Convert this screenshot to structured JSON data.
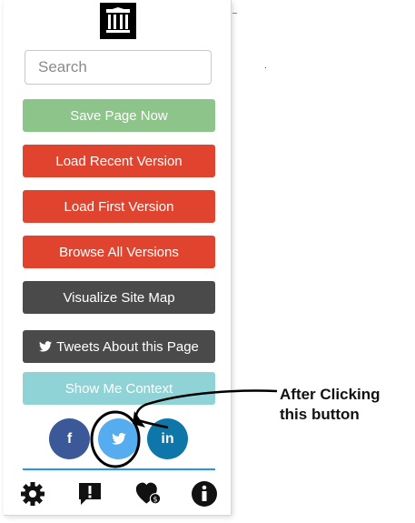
{
  "search": {
    "placeholder": "Search"
  },
  "buttons": {
    "save_page": "Save Page Now",
    "load_recent": "Load Recent Version",
    "load_first": "Load First Version",
    "browse_all": "Browse All Versions",
    "visualize": "Visualize Site Map",
    "tweets": "Tweets About this Page",
    "context": "Show Me Context"
  },
  "social": {
    "facebook": "f",
    "linkedin": "in"
  },
  "icons": {
    "logo": "archive-building-icon",
    "tweets": "twitter-icon",
    "settings": "gear-icon",
    "feedback": "exclamation-speech-icon",
    "donate": "heart-dollar-icon",
    "about": "info-icon"
  },
  "colors": {
    "save": "#8cc489",
    "red": "#e0442f",
    "dark": "#4a4a4a",
    "teal": "#8fd3d6",
    "facebook": "#3b5998",
    "twitter": "#55acee",
    "linkedin": "#0e76a8",
    "divider": "#2196f3"
  },
  "annotation": {
    "text": "After Clicking\nthis button"
  }
}
